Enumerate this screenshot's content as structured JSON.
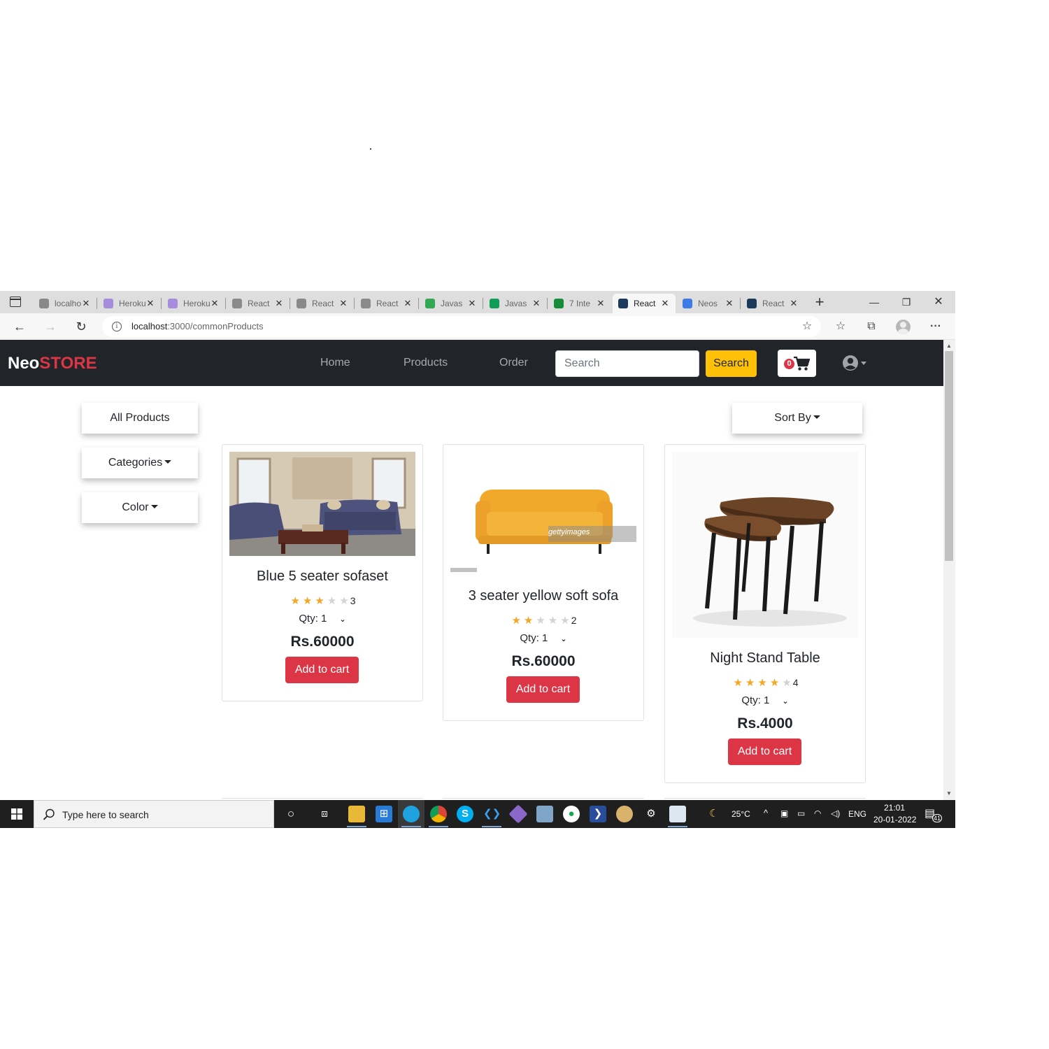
{
  "browser": {
    "tabs": [
      {
        "title": "localhost",
        "icon": "page-icon",
        "color": "#888888",
        "active": false
      },
      {
        "title": "Heroku",
        "icon": "heroku-icon",
        "color": "#a78bdc",
        "active": false
      },
      {
        "title": "Heroku",
        "icon": "heroku-icon",
        "color": "#a78bdc",
        "active": false
      },
      {
        "title": "React",
        "icon": "react-icon",
        "color": "#8a8a8a",
        "active": false
      },
      {
        "title": "React",
        "icon": "react-icon",
        "color": "#8a8a8a",
        "active": false
      },
      {
        "title": "React",
        "icon": "react-icon",
        "color": "#8a8a8a",
        "active": false
      },
      {
        "title": "Javas",
        "icon": "sheets-icon",
        "color": "#33a852",
        "active": false
      },
      {
        "title": "Javas",
        "icon": "sheets-icon",
        "color": "#0f9d58",
        "active": false
      },
      {
        "title": "7 Inte",
        "icon": "dp-icon",
        "color": "#168c3a",
        "active": false
      },
      {
        "title": "React",
        "icon": "react-icon",
        "color": "#1b3a5c",
        "active": true
      },
      {
        "title": "Neos",
        "icon": "docs-icon",
        "color": "#3d7ce8",
        "active": false
      },
      {
        "title": "React",
        "icon": "react-icon",
        "color": "#1b3a5c",
        "active": false
      }
    ],
    "url_host": "localhost",
    "url_path": ":3000/commonProducts"
  },
  "navbar": {
    "brand_neo": "Neo",
    "brand_store": "STORE",
    "links": [
      "Home",
      "Products",
      "Order"
    ],
    "search_placeholder": "Search",
    "search_button": "Search",
    "cart_count": "0"
  },
  "sidebar": {
    "all_products": "All Products",
    "categories": "Categories",
    "color": "Color"
  },
  "sort_label": "Sort By",
  "products": [
    {
      "name": "Blue 5 seater sofaset",
      "rating": 3,
      "rating_label": "3",
      "qty": "Qty: 1",
      "price": "Rs.60000",
      "button": "Add to cart"
    },
    {
      "name": "3 seater yellow soft sofa",
      "rating": 2,
      "rating_label": "2",
      "qty": "Qty: 1",
      "price": "Rs.60000",
      "button": "Add to cart"
    },
    {
      "name": "Night Stand Table",
      "rating": 4,
      "rating_label": "4",
      "qty": "Qty: 1",
      "price": "Rs.4000",
      "button": "Add to cart"
    }
  ],
  "image_text": {
    "watermark": "gettyimages"
  },
  "taskbar": {
    "search_text": "Type here to search",
    "weather": "25°C",
    "language": "ENG",
    "time": "21:01",
    "date": "20-01-2022",
    "notifications": "41"
  },
  "colors": {
    "navbar": "#212529",
    "brand_accent": "#dc3545",
    "search_button": "#ffc107",
    "add_button": "#dc3545",
    "star_on": "#f5a623"
  }
}
